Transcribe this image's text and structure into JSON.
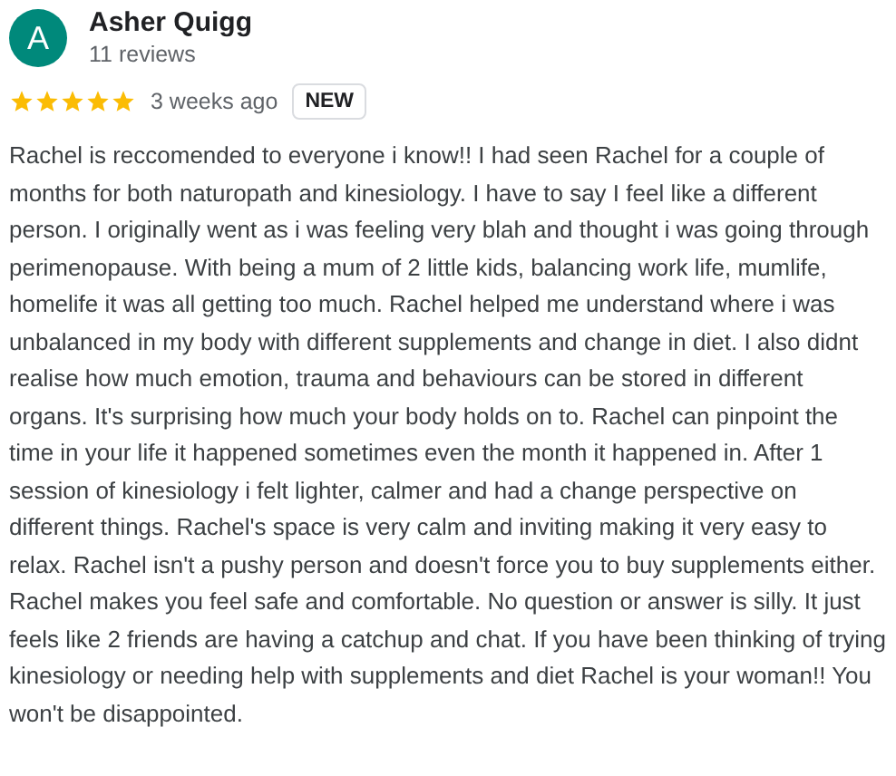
{
  "reviewer": {
    "initial": "A",
    "name": "Asher Quigg",
    "reviews": "11 reviews"
  },
  "rating": {
    "stars": 5,
    "time": "3 weeks ago",
    "badge": "NEW"
  },
  "text": "Rachel is reccomended to everyone i know!! I had seen Rachel for a couple of months for both naturopath and kinesiology. I have to say I feel like a different person. I originally went as i was feeling very blah and thought i was going through perimenopause. With being a mum of 2 little kids, balancing work life, mumlife, homelife it was all getting too much. Rachel helped me understand where i was unbalanced in my body with different supplements and change in diet. I also didnt realise how much emotion, trauma and behaviours can be stored in different organs. It's surprising how much your body holds on to. Rachel can pinpoint the time in your life it happened sometimes even the month it happened in. After 1 session of kinesiology i felt lighter, calmer and had a change perspective on different things. Rachel's space is very calm and inviting making it very easy to relax. Rachel isn't a pushy person and doesn't force you to buy supplements either. Rachel makes you feel safe and comfortable. No question or answer is silly. It just feels like 2 friends are having a catchup and chat. If you have been thinking of trying kinesiology or needing help with supplements and diet Rachel is your woman!! You won't be disappointed."
}
